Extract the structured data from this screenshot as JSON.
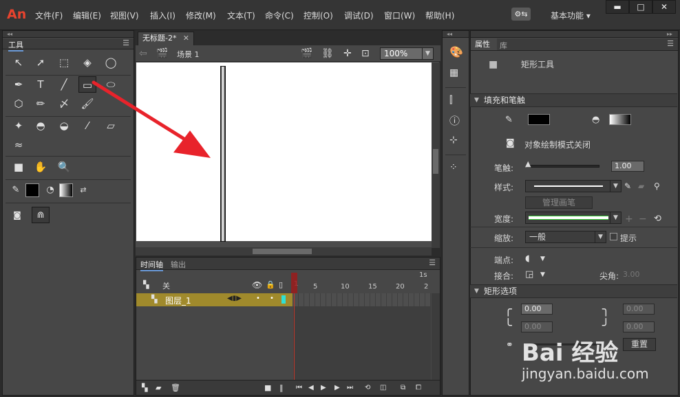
{
  "app": {
    "logo": "An"
  },
  "menu": [
    "文件(F)",
    "编辑(E)",
    "视图(V)",
    "插入(I)",
    "修改(M)",
    "文本(T)",
    "命令(C)",
    "控制(O)",
    "调试(D)",
    "窗口(W)",
    "帮助(H)"
  ],
  "workspace": "基本功能",
  "tools_panel": {
    "tab": "工具"
  },
  "document": {
    "tab": "无标题-2*",
    "scene": "场景 1",
    "zoom": "100%"
  },
  "timeline": {
    "tabs": [
      "时间轴",
      "输出"
    ],
    "header_label": "关",
    "layer_name": "图层_1",
    "ruler": [
      "1",
      "5",
      "10",
      "15",
      "20",
      "2"
    ],
    "ruler_seconds": "1s"
  },
  "properties": {
    "tabs": [
      "属性",
      "库"
    ],
    "tool_name": "矩形工具",
    "section_fill": "填充和笔触",
    "object_draw": "对象绘制模式关闭",
    "stroke_label": "笔触:",
    "stroke_value": "1.00",
    "style_label": "样式:",
    "manage_brush": "管理画笔",
    "width_label": "宽度:",
    "scale_label": "缩放:",
    "scale_value": "一般",
    "hint_label": "提示",
    "cap_label": "端点:",
    "join_label": "接合:",
    "miter_label": "尖角:",
    "miter_value": "3.00",
    "section_rect": "矩形选项",
    "corner_tl": "0.00",
    "corner_tr": "0.00",
    "corner_bl": "0.00",
    "corner_br": "0.00",
    "reset_button": "重置"
  },
  "colors": {
    "accent_arrow": "#e8232b",
    "layer_highlight": "#a08a2c",
    "playhead": "#9b1c1c"
  },
  "watermark": {
    "text": "Bai 经验",
    "url": "jingyan.baidu.com"
  }
}
